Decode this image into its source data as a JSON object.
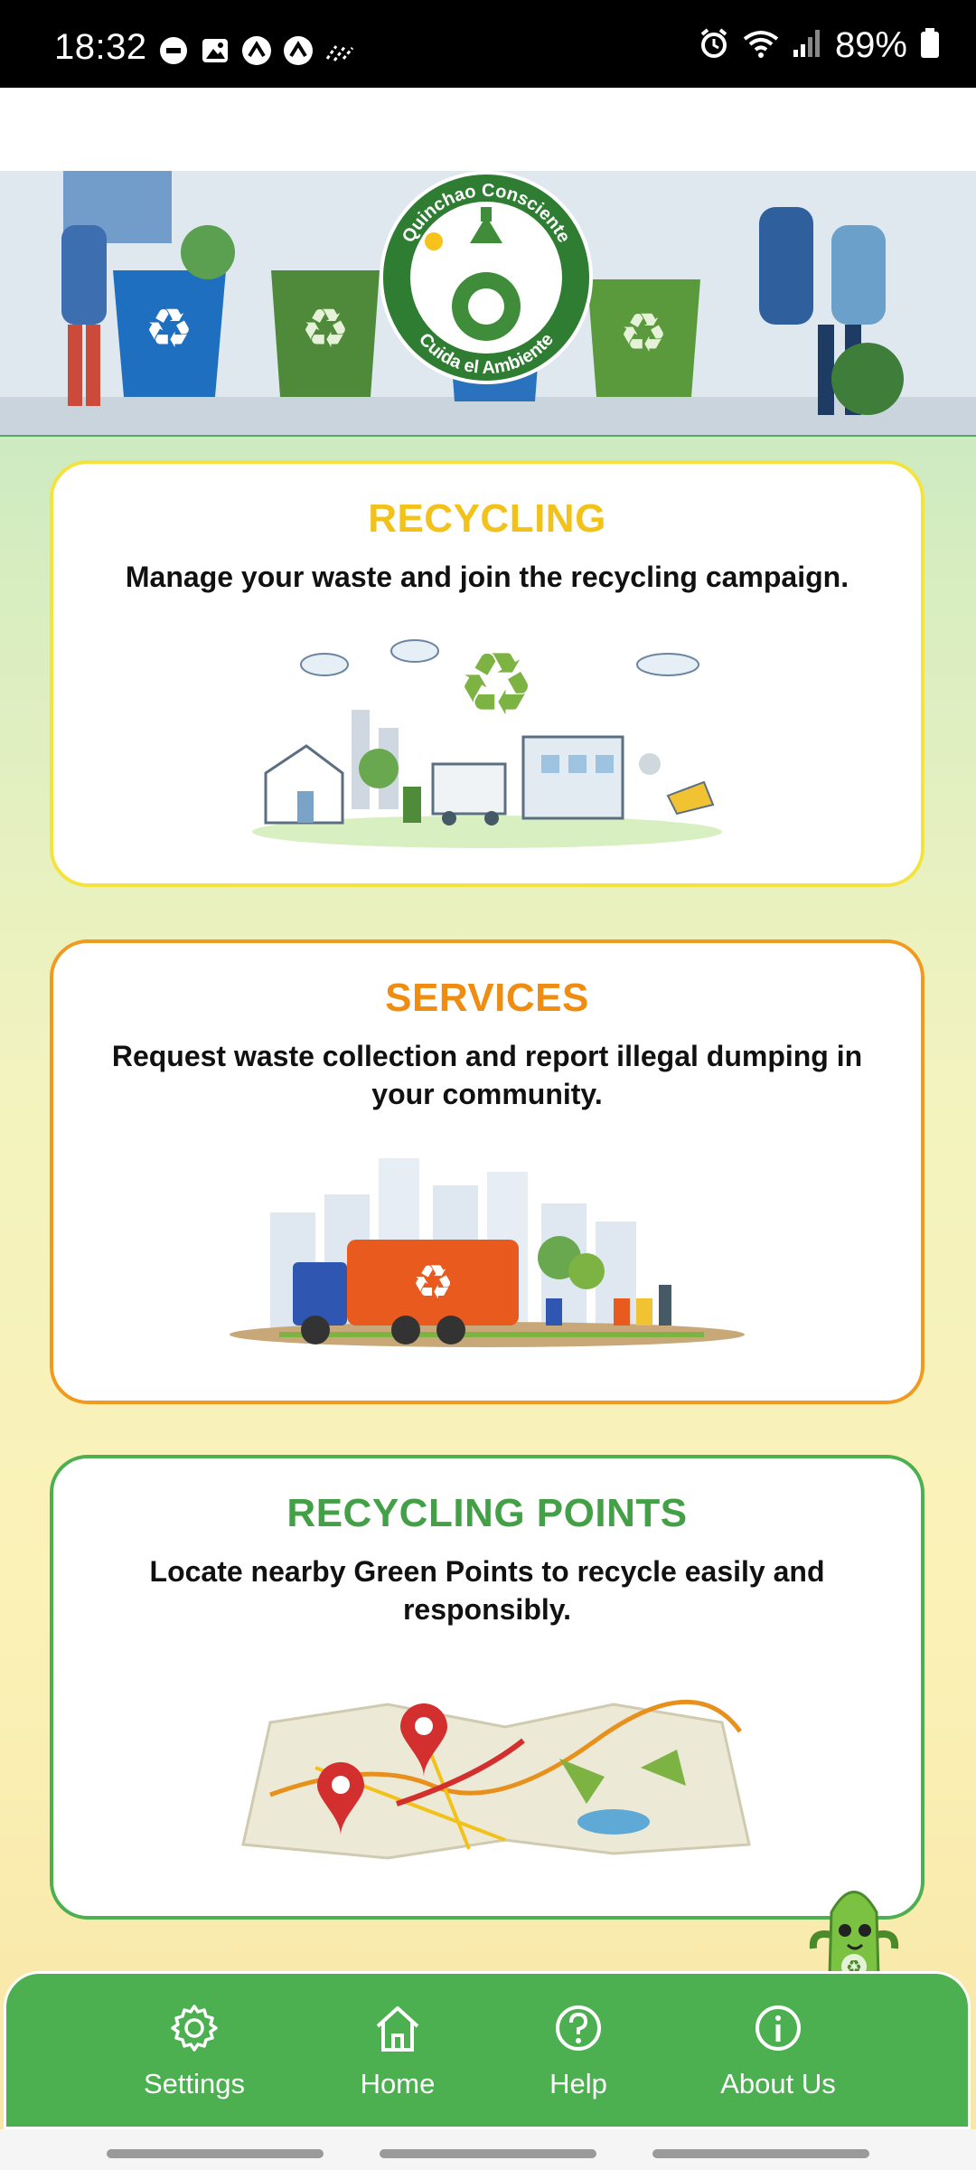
{
  "status_bar": {
    "time": "18:32",
    "battery": "89%",
    "left_icons": [
      "do-not-disturb-icon",
      "gallery-icon",
      "app-icon",
      "app-icon",
      "wifi-calling-icon"
    ],
    "right_icons": [
      "alarm-icon",
      "wifi-icon",
      "signal-icon",
      "battery-icon"
    ]
  },
  "banner": {
    "logo_text_top": "Quinchao Consciente",
    "logo_text_bottom": "Cuida el Ambiente"
  },
  "cards": {
    "recycling": {
      "title": "RECYCLING",
      "description": "Manage your waste and join the recycling campaign.",
      "color": "#f2c21b"
    },
    "services": {
      "title": "SERVICES",
      "description": "Request waste collection and report illegal dumping in your community.",
      "color": "#ef8d12"
    },
    "points": {
      "title": "RECYCLING POINTS",
      "description": "Locate nearby Green Points to recycle easily and responsibly.",
      "color": "#43a047"
    }
  },
  "bottom_nav": {
    "settings": "Settings",
    "home": "Home",
    "help": "Help",
    "about": "About Us"
  },
  "colors": {
    "nav_bg": "#4caf50",
    "accent_green": "#43a047"
  }
}
